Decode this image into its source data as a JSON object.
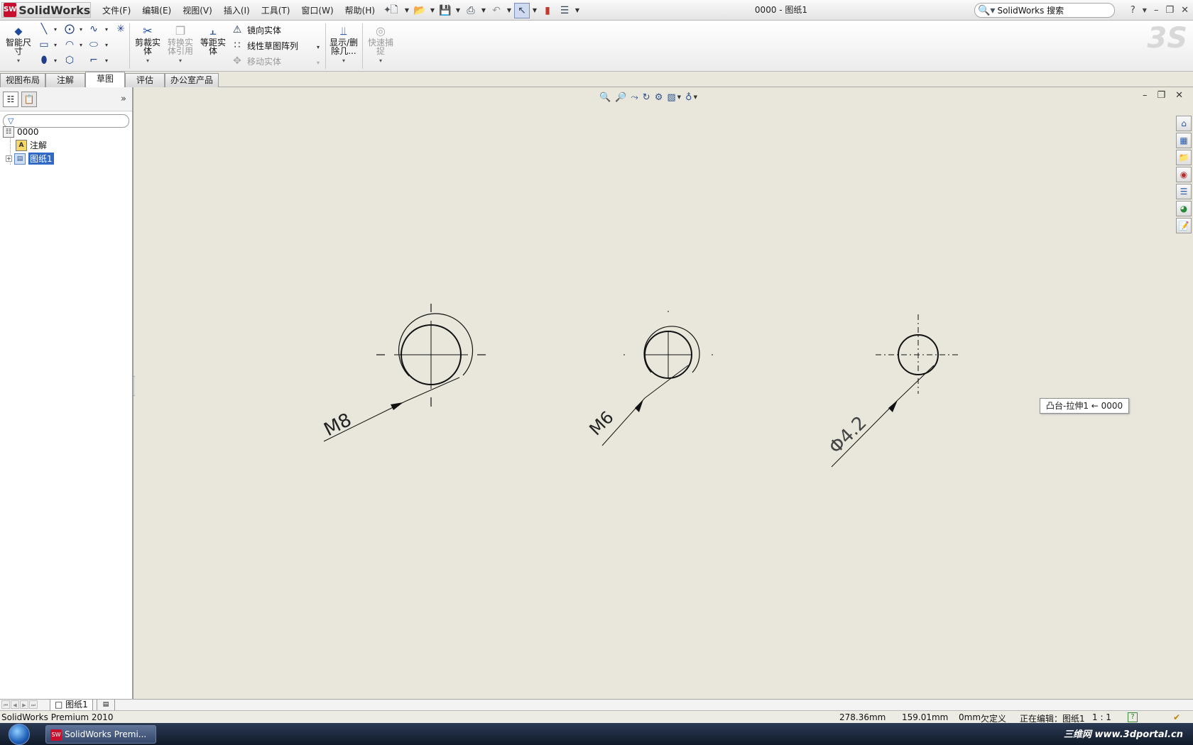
{
  "app": {
    "logo_text": "SolidWorks",
    "doc_title": "0000 - 图纸1"
  },
  "menus": [
    "文件(F)",
    "编辑(E)",
    "视图(V)",
    "插入(I)",
    "工具(T)",
    "窗口(W)",
    "帮助(H)"
  ],
  "search": {
    "value": "SolidWorks 搜索"
  },
  "help_label": "?",
  "commands": {
    "smart_dim": "智能尺寸",
    "trim": "剪裁实体",
    "convert": "转换实体引用",
    "offset": "等距实体",
    "mirror": "镜向实体",
    "linear_pattern": "线性草图阵列",
    "move": "移动实体",
    "show_delete": "显示/删除几...",
    "quick_snap": "快速捕捉"
  },
  "tabs": [
    {
      "label": "视图布局",
      "active": false
    },
    {
      "label": "注解",
      "active": false
    },
    {
      "label": "草图",
      "active": true
    },
    {
      "label": "评估",
      "active": false
    },
    {
      "label": "办公室产品",
      "active": false
    }
  ],
  "tree": {
    "root": "0000",
    "annotations": "注解",
    "sheet": "图纸1"
  },
  "drawing": {
    "labels": [
      "M8",
      "M6",
      "Φ4.2"
    ],
    "tooltip": "凸台-拉伸1 ← 0000"
  },
  "sheet_tab": "图纸1",
  "status": {
    "product": "SolidWorks Premium 2010",
    "x": "278.36mm",
    "y": "159.01mm",
    "z": "0mm",
    "state": "欠定义",
    "editing": "正在编辑：图纸1",
    "scale": "1 : 1"
  },
  "taskbar": {
    "task_label": "SolidWorks Premi...",
    "watermark": "三维网 www.3dportal.cn"
  },
  "colors": {
    "selection": "#3169c6",
    "graphics_bg": "#e9e7dc",
    "taskbar": "#1b2740"
  }
}
